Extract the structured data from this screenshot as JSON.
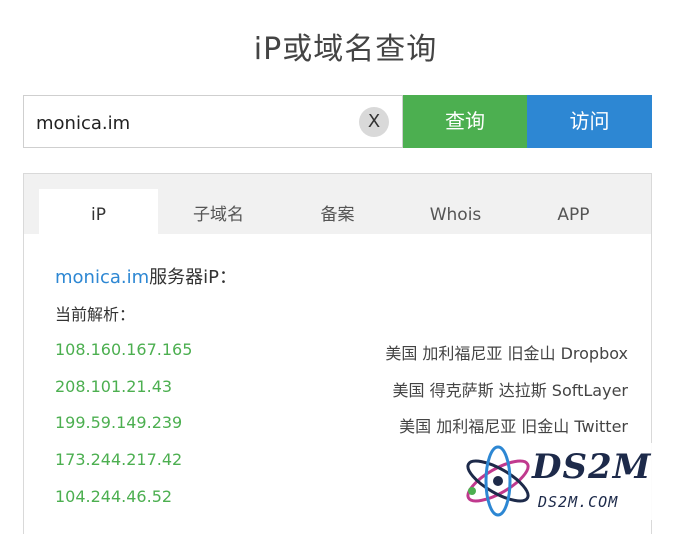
{
  "page": {
    "title": "iP或域名查询"
  },
  "search": {
    "value": "monica.im",
    "clear_label": "X",
    "query_label": "查询",
    "visit_label": "访问"
  },
  "tabs": [
    {
      "label": "iP",
      "active": true
    },
    {
      "label": "子域名"
    },
    {
      "label": "备案"
    },
    {
      "label": "Whois"
    },
    {
      "label": "APP"
    }
  ],
  "result": {
    "domain": "monica.im",
    "server_suffix": "服务器iP：",
    "current_label": "当前解析：",
    "records": [
      {
        "ip": "108.160.167.165",
        "location": "美国 加利福尼亚 旧金山 Dropbox"
      },
      {
        "ip": "208.101.21.43",
        "location": "美国 得克萨斯 达拉斯 SoftLayer"
      },
      {
        "ip": "199.59.149.239",
        "location": "美国 加利福尼亚 旧金山 Twitter"
      },
      {
        "ip": "173.244.217.42",
        "location": ""
      },
      {
        "ip": "104.244.46.52",
        "location": ""
      }
    ]
  },
  "watermark": {
    "logo": "DS2M",
    "url": "DS2M.COM"
  },
  "colors": {
    "green": "#4caf50",
    "blue": "#2d87d3"
  }
}
